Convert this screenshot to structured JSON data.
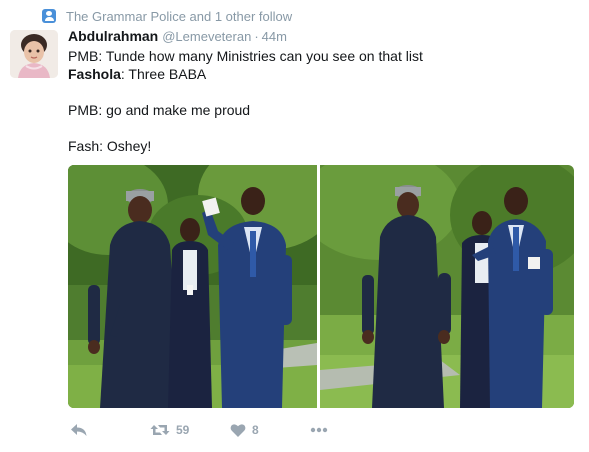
{
  "context": {
    "icon": "person-follow-icon",
    "text": "The Grammar Police and 1 other follow"
  },
  "tweet": {
    "author_name": "Abdulrahman",
    "handle": "@Lemeveteran",
    "separator": "·",
    "time": "44m",
    "lines": {
      "l1": "PMB: Tunde how many Ministries can you see on that list",
      "l2_speaker": "Fashola",
      "l2_rest": ": Three BABA",
      "l3": "PMB: go and make me proud",
      "l4": "Fash: Oshey!"
    }
  },
  "actions": {
    "reply_icon": "reply-icon",
    "retweet_icon": "retweet-icon",
    "retweet_count": "59",
    "like_icon": "heart-icon",
    "like_count": "8",
    "more_icon": "more-dots-icon"
  },
  "colors": {
    "muted": "#8899a6",
    "icon": "#9aa6b1",
    "context_icon": "#4a90d9"
  }
}
